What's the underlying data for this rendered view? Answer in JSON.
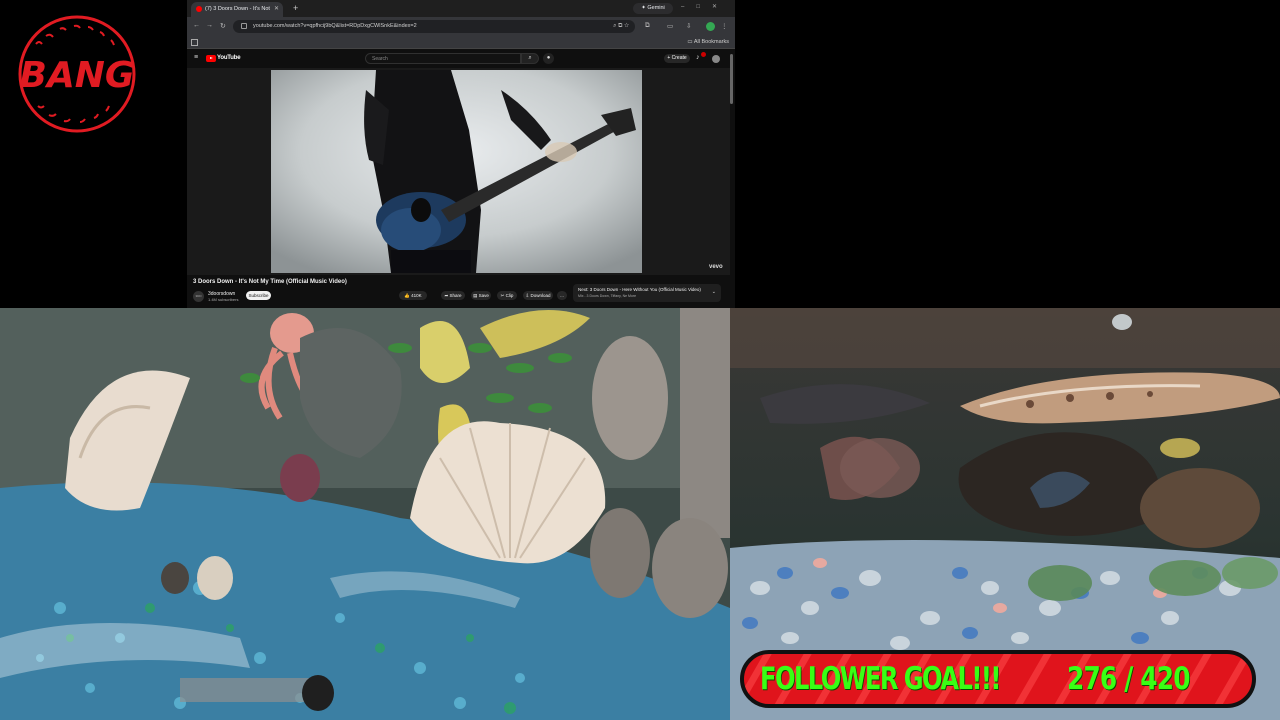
{
  "logo": {
    "text": "BANG",
    "color": "#e11b22"
  },
  "browser": {
    "tab_title": "(7) 3 Doors Down - It's Not",
    "new_tab_icon": "plus-icon",
    "gemini_label": "Gemini",
    "url": "youtube.com/watch?v=qpfhcij9bQ&list=RDpDxgCWlSnkE&index=2",
    "bookmarks_label": "All Bookmarks"
  },
  "youtube": {
    "brand": "YouTube",
    "search_placeholder": "Search",
    "create_label": "+ Create",
    "video_title": "3 Doors Down - It's Not My Time (Official Music Video)",
    "channel_name": "3doorsdown",
    "channel_subs": "1.4M subscribers",
    "subscribe_label": "Subscribe",
    "like_count": "410K",
    "share_label": "Share",
    "save_label": "Save",
    "clip_label": "Clip",
    "download_label": "Download",
    "more_label": "...",
    "vevo_label": "vevo",
    "next_title": "Next: 3 Doors Down - Here Without You (Official Music Video)",
    "next_sub": "Mix - 3 Doors Down, Tiffany, Ne More",
    "accent": "#ff0000"
  },
  "goal": {
    "label": "FOLLOWER GOAL!!!",
    "current": 276,
    "target": 420,
    "count_text": "276 / 420",
    "text_color": "#39ff14",
    "bar_color": "#e0141c"
  }
}
